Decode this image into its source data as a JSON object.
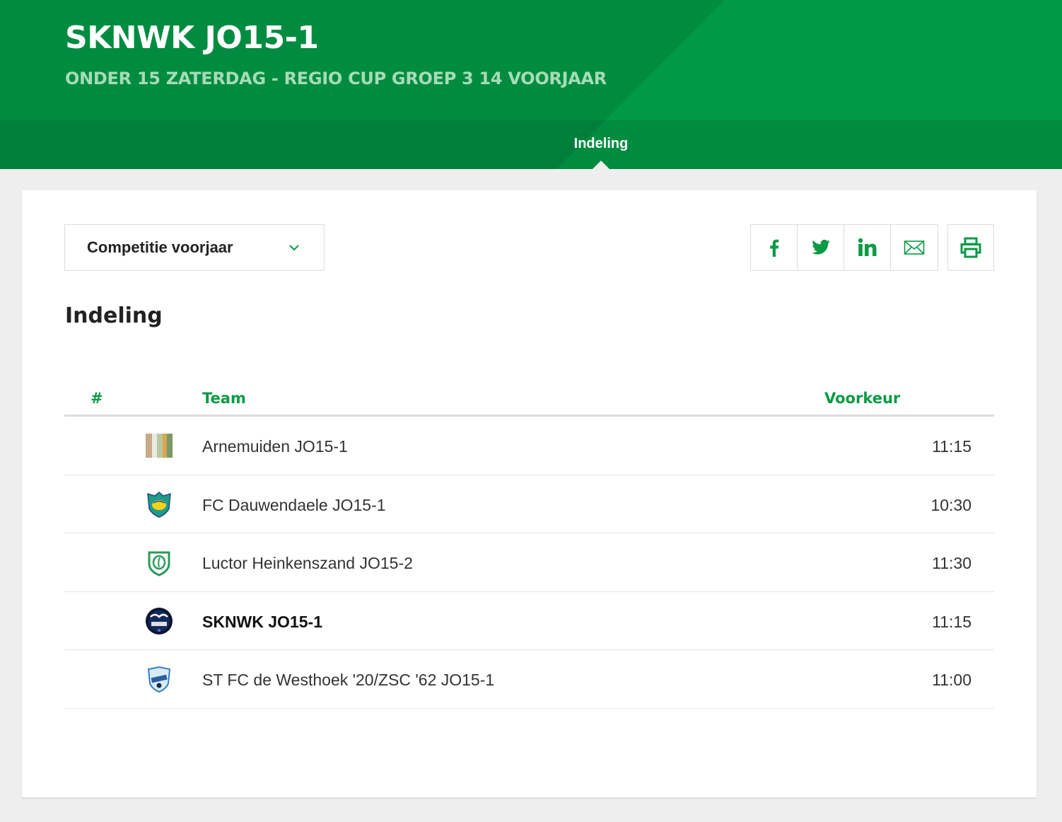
{
  "header": {
    "title": "SKNWK JO15-1",
    "subtitle": "ONDER 15 ZATERDAG - REGIO CUP GROEP 3 14 VOORJAAR",
    "tab_label": "Indeling"
  },
  "colors": {
    "brand_green": "#009a44",
    "dark_green": "#007f3b",
    "accent_text": "#0a9a44"
  },
  "filter": {
    "selected": "Competitie voorjaar"
  },
  "share_icons": [
    "facebook-icon",
    "twitter-icon",
    "linkedin-icon",
    "mail-icon",
    "print-icon"
  ],
  "section": {
    "title": "Indeling"
  },
  "table": {
    "columns": [
      "#",
      "Team",
      "Voorkeur"
    ],
    "rows": [
      {
        "team": "Arnemuiden JO15-1",
        "time": "11:15"
      },
      {
        "team": "FC Dauwendaele JO15-1",
        "time": "10:30"
      },
      {
        "team": "Luctor Heinkenszand JO15-2",
        "time": "11:30"
      },
      {
        "team": "SKNWK JO15-1",
        "time": "11:15"
      },
      {
        "team": "ST FC de Westhoek '20/ZSC '62 JO15-1",
        "time": "11:00"
      }
    ]
  }
}
